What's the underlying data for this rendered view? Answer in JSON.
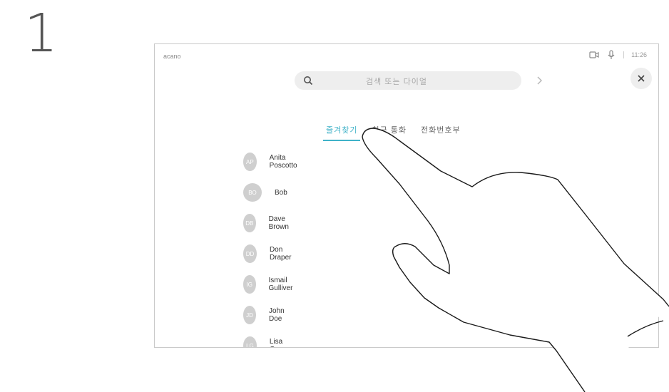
{
  "step": "1",
  "device": {
    "name": "acano",
    "status": {
      "time": "11:26",
      "icons": [
        "camera-icon",
        "mic-icon"
      ]
    },
    "search": {
      "placeholder": "검색 또는 다이얼"
    },
    "tabs": [
      {
        "label": "즐겨찾기",
        "active": true
      },
      {
        "label": "최근 통화",
        "active": false
      },
      {
        "label": "전화번호부",
        "active": false
      }
    ],
    "contacts": [
      {
        "initials": "AP",
        "name": "Anita Poscotto"
      },
      {
        "initials": "BO",
        "name": "Bob"
      },
      {
        "initials": "DB",
        "name": "Dave Brown"
      },
      {
        "initials": "DD",
        "name": "Don Draper"
      },
      {
        "initials": "IG",
        "name": "Ismail Gulliver"
      },
      {
        "initials": "JD",
        "name": "John Doe"
      },
      {
        "initials": "LG",
        "name": "Lisa Gonzo"
      }
    ]
  },
  "colors": {
    "accent": "#3fb2c8",
    "avatar": "#cfcfcf",
    "surface": "#eeeeee"
  }
}
